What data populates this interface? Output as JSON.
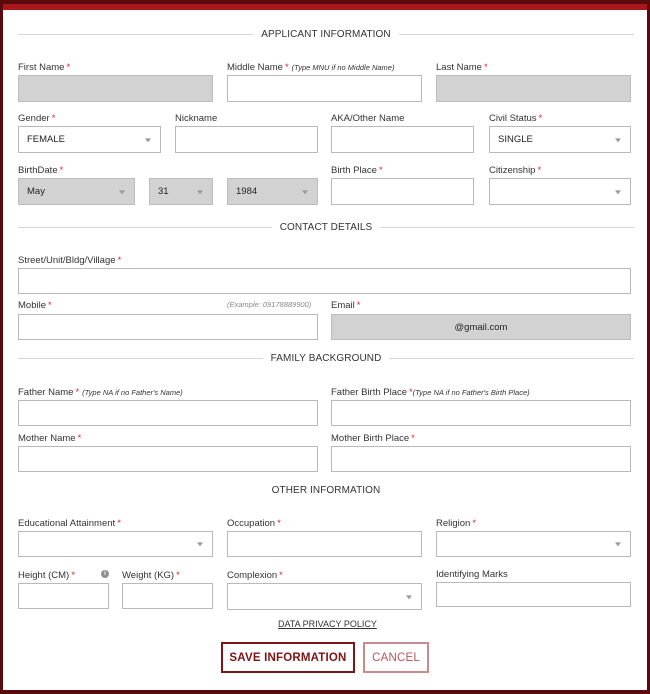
{
  "sections": {
    "applicant": "APPLICANT INFORMATION",
    "contact": "CONTACT DETAILS",
    "family": "FAMILY BACKGROUND",
    "other": "OTHER INFORMATION"
  },
  "required_mark": "*",
  "applicant": {
    "first_name": {
      "label": "First Name",
      "value": ""
    },
    "middle_name": {
      "label": "Middle Name",
      "hint": "(Type MNU if no Middle Name)",
      "value": ""
    },
    "last_name": {
      "label": "Last Name",
      "value": ""
    },
    "gender": {
      "label": "Gender",
      "value": "FEMALE"
    },
    "nickname": {
      "label": "Nickname",
      "value": ""
    },
    "aka": {
      "label": "AKA/Other Name",
      "value": ""
    },
    "civil_status": {
      "label": "Civil Status",
      "value": "SINGLE"
    },
    "birthdate": {
      "label": "BirthDate",
      "month": "May",
      "day": "31",
      "year": "1984"
    },
    "birth_place": {
      "label": "Birth Place",
      "value": ""
    },
    "citizenship": {
      "label": "Citizenship",
      "value": ""
    }
  },
  "contact": {
    "street": {
      "label": "Street/Unit/Bldg/Village",
      "value": ""
    },
    "mobile": {
      "label": "Mobile",
      "example": "(Example: 09178889900)",
      "value": ""
    },
    "email": {
      "label": "Email",
      "value": "@gmail.com"
    }
  },
  "family": {
    "father_name": {
      "label": "Father Name",
      "hint": "(Type NA if no Father's Name)",
      "value": ""
    },
    "father_birth_place": {
      "label": "Father Birth Place",
      "hint": "(Type NA if no Father's Birth Place)",
      "value": ""
    },
    "mother_name": {
      "label": "Mother Name",
      "value": ""
    },
    "mother_birth_place": {
      "label": "Mother Birth Place",
      "value": ""
    }
  },
  "other": {
    "education": {
      "label": "Educational Attainment",
      "value": ""
    },
    "occupation": {
      "label": "Occupation",
      "value": ""
    },
    "religion": {
      "label": "Religion",
      "value": ""
    },
    "height": {
      "label": "Height (CM)",
      "info_icon": "i",
      "value": ""
    },
    "weight": {
      "label": "Weight (KG)",
      "value": ""
    },
    "complexion": {
      "label": "Complexion",
      "value": ""
    },
    "identifying_marks": {
      "label": "Identifying Marks",
      "value": ""
    }
  },
  "footer": {
    "privacy_link": "DATA PRIVACY POLICY",
    "save_label": "SAVE INFORMATION",
    "cancel_label": "CANCEL"
  },
  "colors": {
    "frame": "#5a0a0c",
    "topband": "#a8181b",
    "accent": "#7d1416",
    "required": "#e0262b",
    "disabled_field": "#d2d2d2"
  }
}
